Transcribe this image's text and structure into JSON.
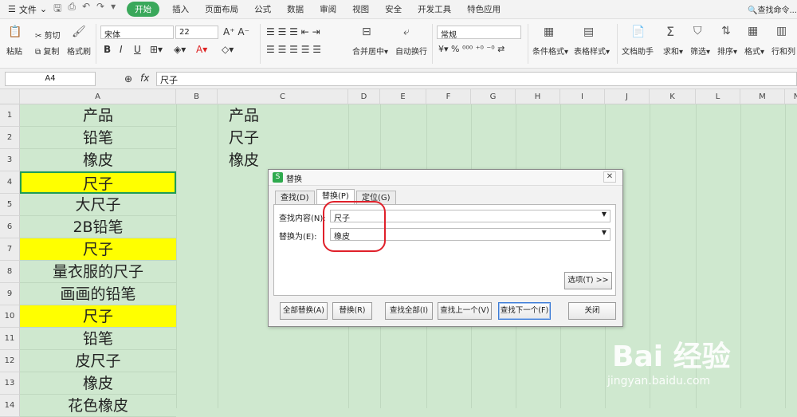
{
  "menu": {
    "file": "文件",
    "tabs": [
      "开始",
      "插入",
      "页面布局",
      "公式",
      "数据",
      "审阅",
      "视图",
      "安全",
      "开发工具",
      "特色应用"
    ],
    "active_tab": "开始",
    "search": "查找命令..."
  },
  "ribbon": {
    "paste": "粘贴",
    "cut": "剪切",
    "copy": "复制",
    "format_painter": "格式刷",
    "font": "宋体",
    "font_size": "22",
    "merge": "合并居中",
    "wrap": "自动换行",
    "number_format": "常规",
    "cond_format": "条件格式",
    "table_style": "表格样式",
    "doc_helper": "文档助手",
    "sum": "求和",
    "filter": "筛选",
    "sort": "排序",
    "format": "格式",
    "rows_cols": "行和列"
  },
  "formula_bar": {
    "name_box": "A4",
    "fx": "fx",
    "content": "尺子"
  },
  "grid": {
    "columns": [
      "A",
      "B",
      "C",
      "D",
      "E",
      "F",
      "G",
      "H",
      "I",
      "J",
      "K",
      "L",
      "M",
      "N"
    ],
    "rows": [
      "1",
      "2",
      "3",
      "4",
      "5",
      "6",
      "7",
      "8",
      "9",
      "10",
      "11",
      "12",
      "13",
      "14"
    ],
    "colA": [
      "产品",
      "铅笔",
      "橡皮",
      "尺子",
      "大尺子",
      "2B铅笔",
      "尺子",
      "量衣服的尺子",
      "画画的铅笔",
      "尺子",
      "铅笔",
      "皮尺子",
      "橡皮",
      "花色橡皮"
    ],
    "colA_highlight": [
      false,
      false,
      false,
      true,
      false,
      false,
      true,
      false,
      false,
      true,
      false,
      false,
      false,
      false
    ],
    "colC": [
      "产品",
      "尺子",
      "橡皮"
    ],
    "highlight_color": "#ffff00"
  },
  "dialog": {
    "title": "替换",
    "tabs": [
      "查找(D)",
      "替换(P)",
      "定位(G)"
    ],
    "find_label": "查找内容(N):",
    "find_value": "尺子",
    "replace_label": "替换为(E):",
    "replace_value": "橡皮",
    "options": "选项(T) >>",
    "buttons": [
      "全部替换(A)",
      "替换(R)",
      "查找全部(I)",
      "查找上一个(V)",
      "查找下一个(F)",
      "关闭"
    ]
  },
  "watermark": {
    "brand": "Bai 经验",
    "url": "jingyan.baidu.com"
  }
}
